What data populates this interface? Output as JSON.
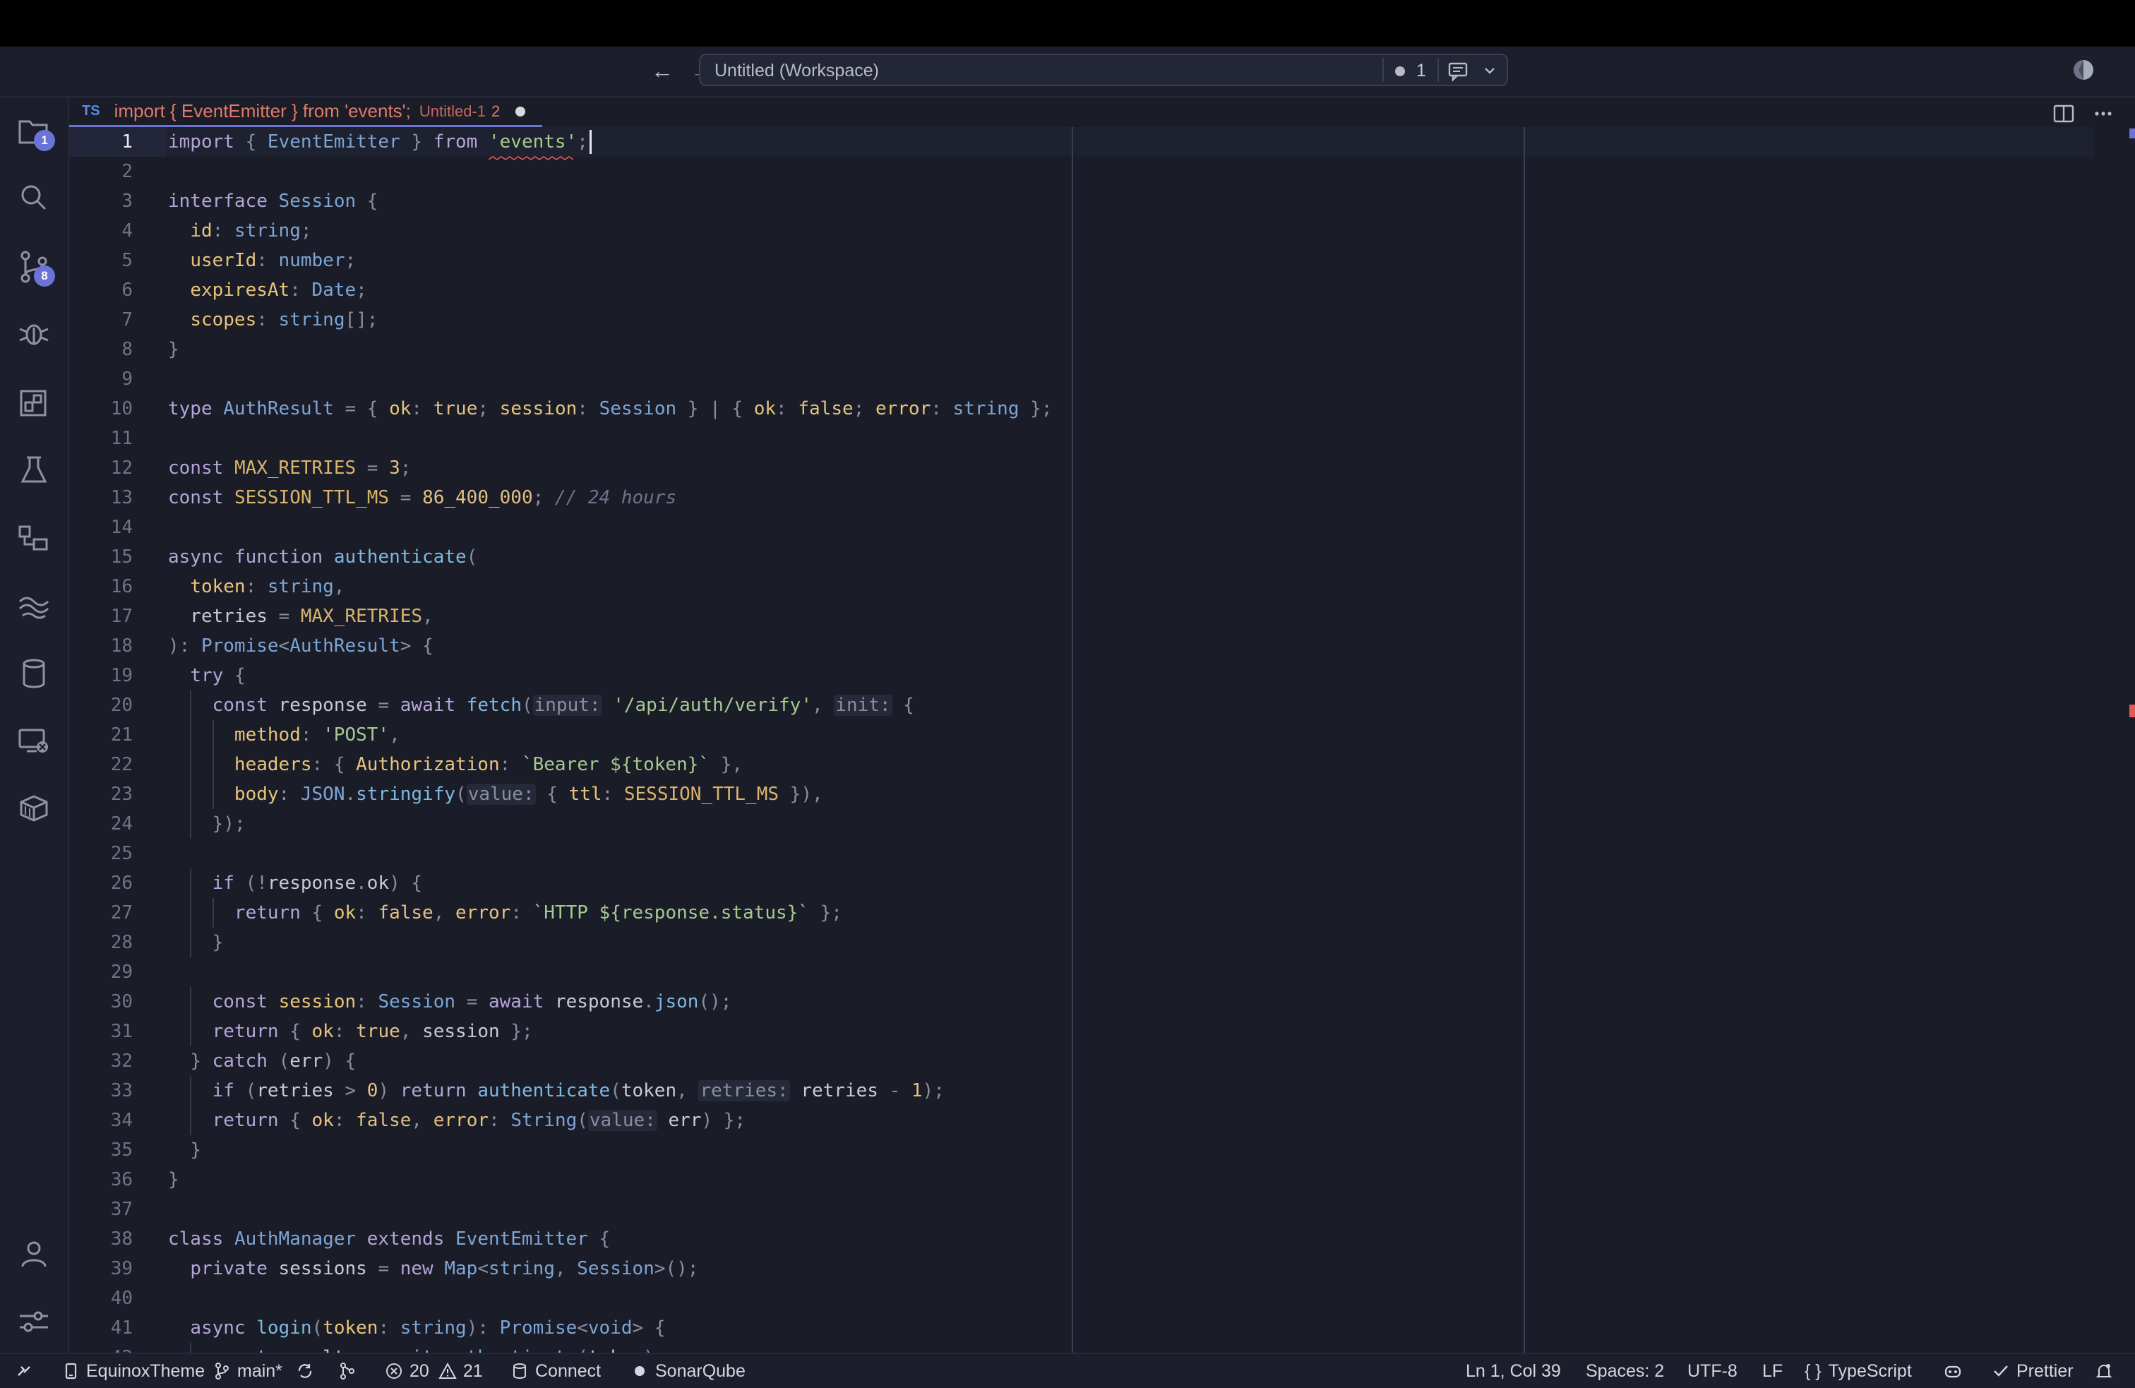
{
  "titlebar": {
    "back_label": "←",
    "forward_label": "→",
    "workspace_title": "Untitled (Workspace)",
    "problems_count": "1"
  },
  "activity": {
    "explorer_badge": "1",
    "scm_badge": "8"
  },
  "tab": {
    "lang": "TS",
    "name": "import { EventEmitter } from 'events';",
    "description": "Untitled-1",
    "problem_count": "2"
  },
  "editor": {
    "active_line": 1,
    "lines": [
      "import { EventEmitter } from 'events';",
      "",
      "interface Session {",
      "  id: string;",
      "  userId: number;",
      "  expiresAt: Date;",
      "  scopes: string[];",
      "}",
      "",
      "type AuthResult = { ok: true; session: Session } | { ok: false; error: string };",
      "",
      "const MAX_RETRIES = 3;",
      "const SESSION_TTL_MS = 86_400_000; // 24 hours",
      "",
      "async function authenticate(",
      "  token: string,",
      "  retries = MAX_RETRIES,",
      "): Promise<AuthResult> {",
      "  try {",
      "    const response = await fetch(input: '/api/auth/verify', init: {",
      "      method: 'POST',",
      "      headers: { Authorization: `Bearer ${token}` },",
      "      body: JSON.stringify(value: { ttl: SESSION_TTL_MS }),",
      "    });",
      "",
      "    if (!response.ok) {",
      "      return { ok: false, error: `HTTP ${response.status}` };",
      "    }",
      "",
      "    const session: Session = await response.json();",
      "    return { ok: true, session };",
      "  } catch (err) {",
      "    if (retries > 0) return authenticate(token, retries: retries - 1);",
      "    return { ok: false, error: String(value: err) };",
      "  }",
      "}",
      "",
      "class AuthManager extends EventEmitter {",
      "  private sessions = new Map<string, Session>();",
      "",
      "  async login(token: string): Promise<void> {",
      "    const result = await authenticate(token);"
    ]
  },
  "statusbar": {
    "remote_icon": "remote-icon",
    "project": "EquinoxTheme",
    "branch": "main*",
    "errors": "20",
    "warnings": "21",
    "connect": "Connect",
    "sonar": "SonarQube",
    "position": "Ln 1, Col 39",
    "spaces": "Spaces: 2",
    "encoding": "UTF-8",
    "eol": "LF",
    "language": "TypeScript",
    "prettier": "Prettier"
  },
  "colors": {
    "accent": "#6b74d6",
    "background": "#1a1c28",
    "error": "#e05a5a"
  }
}
